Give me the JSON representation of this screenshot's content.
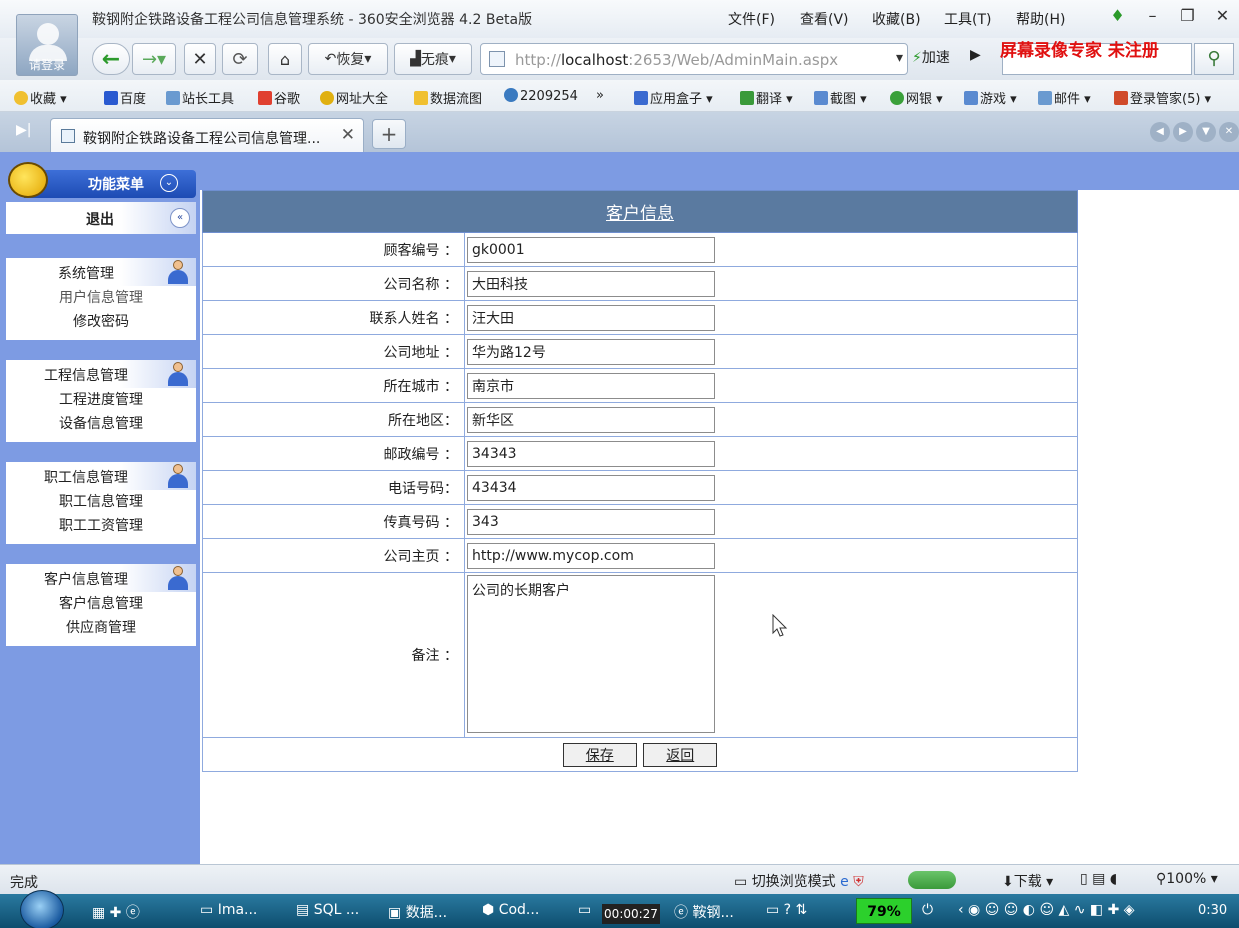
{
  "browser": {
    "window_title": "鞍钢附企铁路设备工程公司信息管理系统 - 360安全浏览器 4.2 Beta版",
    "avatar_label": "请登录",
    "menu": [
      "文件(F)",
      "查看(V)",
      "收藏(B)",
      "工具(T)",
      "帮助(H)"
    ],
    "toolbar": {
      "restore": "恢复",
      "incognito": "无痕",
      "accelerate": "加速"
    },
    "address": {
      "prefix": "http://",
      "host": "localhost",
      "rest": ":2653/Web/AdminMain.aspx"
    },
    "watermark": "屏幕录像专家  未注册",
    "bookmarks": [
      "收藏",
      "百度",
      "站长工具",
      "谷歌",
      "网址大全",
      "数据流图",
      "2209254",
      "»",
      "应用盒子",
      "翻译",
      "截图",
      "网银",
      "游戏",
      "邮件",
      "登录管家(5)"
    ],
    "tab_title": "鞍钢附企铁路设备工程公司信息管理...",
    "status": "完成",
    "status_mode": "切换浏览模式",
    "status_download": "下载",
    "zoom": "100%"
  },
  "sidebar": {
    "title": "功能菜单",
    "logout": "退出",
    "groups": [
      {
        "title": "系统管理",
        "items": [
          "用户信息管理",
          "修改密码"
        ]
      },
      {
        "title": "工程信息管理",
        "items": [
          "工程进度管理",
          "设备信息管理"
        ]
      },
      {
        "title": "职工信息管理",
        "items": [
          "职工信息管理",
          "职工工资管理"
        ]
      },
      {
        "title": "客户信息管理",
        "items": [
          "客户信息管理",
          "供应商管理"
        ]
      }
    ]
  },
  "form": {
    "title": "客户信息",
    "fields": [
      {
        "label": "顾客编号 ：",
        "value": "gk0001"
      },
      {
        "label": "公司名称 ：",
        "value": "大田科技"
      },
      {
        "label": "联系人姓名 ：",
        "value": "汪大田"
      },
      {
        "label": "公司地址 ：",
        "value": "华为路12号"
      },
      {
        "label": "所在城市 ：",
        "value": "南京市"
      },
      {
        "label": "所在地区：",
        "value": "新华区"
      },
      {
        "label": "邮政编号 ：",
        "value": "34343"
      },
      {
        "label": "电话号码：",
        "value": "43434"
      },
      {
        "label": "传真号码 ：",
        "value": "343"
      },
      {
        "label": "公司主页 ：",
        "value": "http://www.mycop.com"
      }
    ],
    "remarks_label": "备注 ：",
    "remarks_value": "公司的长期客户",
    "save": "保存",
    "back": "返回"
  },
  "taskbar": {
    "items": [
      "Ima...",
      "SQL ...",
      "数据...",
      "Cod...",
      "鞍钢..."
    ],
    "recorder": "00:00:27",
    "battery": "79%",
    "clock": "0:30"
  }
}
